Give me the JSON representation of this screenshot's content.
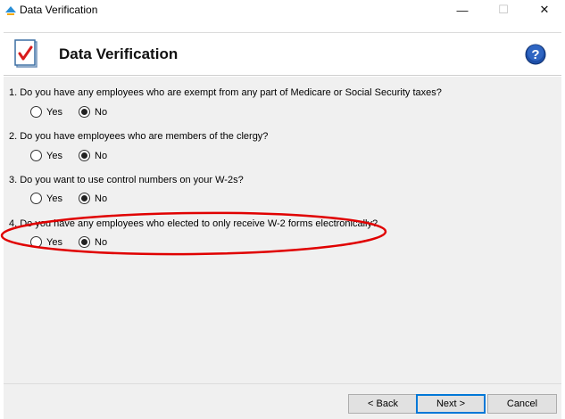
{
  "window": {
    "title": "Data Verification",
    "minimize": "—",
    "maximize": "☐",
    "close": "✕"
  },
  "header": {
    "title": "Data Verification"
  },
  "questions": [
    {
      "text": "1. Do you have any employees who are exempt from any part of Medicare or Social Security taxes?",
      "yes": "Yes",
      "no": "No",
      "selected": "No"
    },
    {
      "text": "2. Do you have employees who are members of the clergy?",
      "yes": "Yes",
      "no": "No",
      "selected": "No"
    },
    {
      "text": "3. Do you want to use control numbers on your W-2s?",
      "yes": "Yes",
      "no": "No",
      "selected": "No"
    },
    {
      "text": "4. Do you have any employees who elected to only receive W-2 forms electronically?",
      "yes": "Yes",
      "no": "No",
      "selected": "No"
    }
  ],
  "footer": {
    "back_label": "< Back",
    "next_label": "Next >",
    "cancel_label": "Cancel"
  },
  "colors": {
    "annotation": "#e00000",
    "help_icon": "#1e4fa8",
    "check": "#d81c1c"
  }
}
